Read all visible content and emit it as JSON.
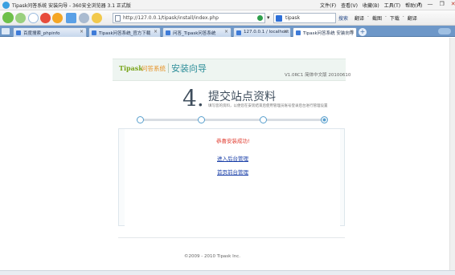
{
  "window": {
    "title": "Tipask问答系统 安装向导 - 360安全浏览器 3.1 正式版",
    "menu": [
      "文件(F)",
      "查看(V)",
      "收藏(B)",
      "工具(T)",
      "帮助(H)"
    ],
    "controls": [
      "▾",
      "—",
      "❐",
      "✕"
    ]
  },
  "navbar": {
    "address": "http://127.0.0.1/tipask/install/index.php",
    "search_engine": "Google",
    "search_value": "tipask",
    "search_button": "搜索",
    "right_items": [
      "翻译",
      "·",
      "截图",
      "·",
      "下载",
      "·",
      "翻译"
    ]
  },
  "tabs": [
    {
      "label": "百度搜索_phpinfo"
    },
    {
      "label": "Tipask问答系统_官方下载"
    },
    {
      "label": "问答_Tipask问答系统"
    },
    {
      "label": "127.0.0.1 / localhost"
    },
    {
      "label": "Tipask问答系统 安装向导",
      "active": true
    }
  ],
  "header": {
    "logo_en": "Tipask",
    "logo_cn": "问答系统",
    "title": "安装向导",
    "version": "V1.0RC1 简体中文版 20100610"
  },
  "step": {
    "number": "4.",
    "title": "提交站点资料",
    "subtitle": "填写您的资料，以便您在安装结束后使用管理员账号登录后台进行管理设置"
  },
  "progress": {
    "total": 4,
    "current": 4
  },
  "result": {
    "message": "恭喜安装成功!",
    "admin_link": "进入后台管理",
    "home_link": "首页前台管理"
  },
  "footer": {
    "copyright": "©2009 - 2010 Tipask Inc."
  }
}
